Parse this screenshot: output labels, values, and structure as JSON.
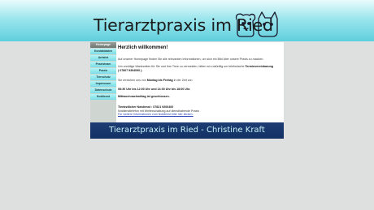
{
  "header": {
    "title": "Tierarztpraxis im Ried"
  },
  "sidebar": {
    "items": [
      {
        "label": "Homepage"
      },
      {
        "label": "Kontaktdaten"
      },
      {
        "label": "Anfahrt"
      },
      {
        "label": "Praxisteam"
      },
      {
        "label": "Praxis"
      },
      {
        "label": "Tierschutz"
      },
      {
        "label": "Impressum"
      },
      {
        "label": "Datenschutz"
      },
      {
        "label": "Notdienst"
      }
    ]
  },
  "main": {
    "heading": "Herzlich willkommen!",
    "intro": "Auf unserer Homepage finden Sie alle relevanten Informationen, um sich ein Bild über unsere Praxis zu machen.",
    "appointment_line1_pre": "Um unnötige Wartezeiten für Sie und Ihre Tiere zu vermeiden, bitten wir zukünftig um telefonische ",
    "appointment_line1_bold": "Terminvereinbarung",
    "appointment_phone": "( 07807 9394090 ).",
    "hours_pre": "Sie erreichen uns von ",
    "hours_bold": "Montag bis Freitag",
    "hours_post": " in der Zeit von",
    "hours_times": "08:30 Uhr bis 12:00 Uhr und 14:00 Uhr bis 18:00 Uhr.",
    "closed_note": "Mittwochnachmittag ist geschlossen.",
    "emergency_heading": "Tierärztlicher Notdienst : 07821 9206400",
    "emergency_text": "Notdiensttelefon mit Weiterschaltung auf diensthabende Praxis",
    "emergency_link": "Für weitere Informationen zum Notdienst bitte hier klicken."
  },
  "footer": {
    "title": "Tierarztpraxis im Ried - Christine Kraft"
  },
  "colors": {
    "banner": "#6fd5e1",
    "nav": "#8fe4ea",
    "footer": "#173668"
  }
}
